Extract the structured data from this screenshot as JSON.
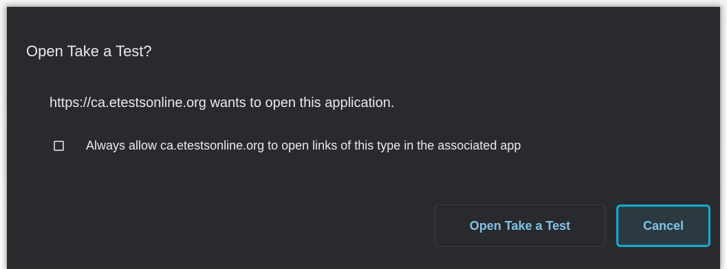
{
  "dialog": {
    "title": "Open Take a Test?",
    "message": "https://ca.etestsonline.org wants to open this application.",
    "checkbox": {
      "label": "Always allow ca.etestsonline.org to open links of this type in the associated app",
      "checked": false
    },
    "buttons": {
      "open_label": "Open Take a Test",
      "cancel_label": "Cancel"
    }
  },
  "colors": {
    "background": "#292a2d",
    "text": "#e8eaed",
    "accent": "#1ea5c8",
    "button_text": "#7fc4e9"
  }
}
